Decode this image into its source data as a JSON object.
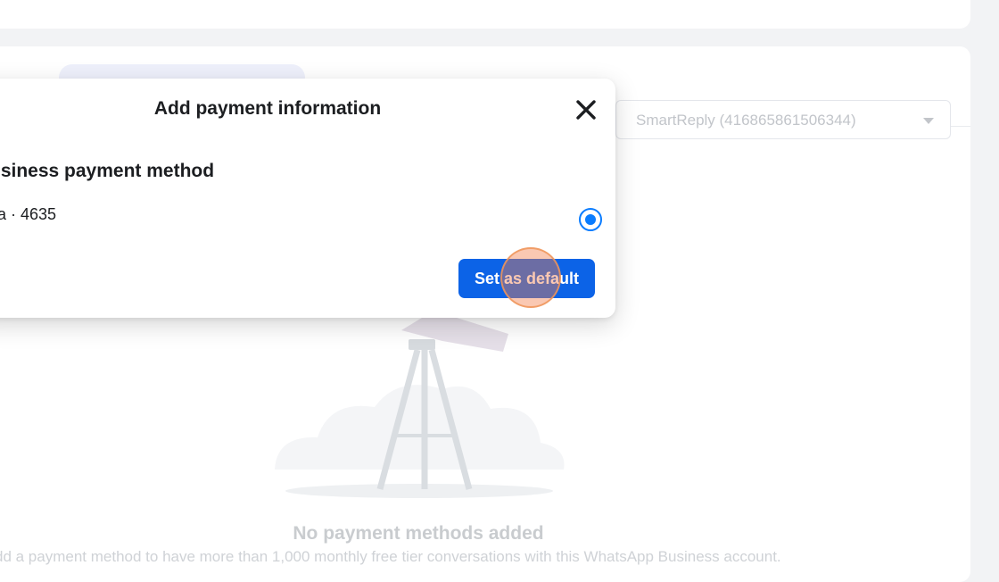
{
  "background": {
    "account_select": {
      "value": "SmartReply (416865861506344)"
    },
    "empty_state": {
      "title": "No payment methods added",
      "description": "dd a payment method to have more than 1,000 monthly free tier conversations with this WhatsApp Business account."
    }
  },
  "modal": {
    "title": "Add payment information",
    "section_title": "usiness payment method",
    "payment_method_label": "sa · 4635",
    "radio_selected": true,
    "primary_button_label": "Set as default"
  },
  "colors": {
    "primary": "#0c63e7",
    "radio": "#0a7cff",
    "click_marker": "#f47c48"
  },
  "icons": {
    "close": "close-icon",
    "dropdown": "caret-down-icon"
  }
}
